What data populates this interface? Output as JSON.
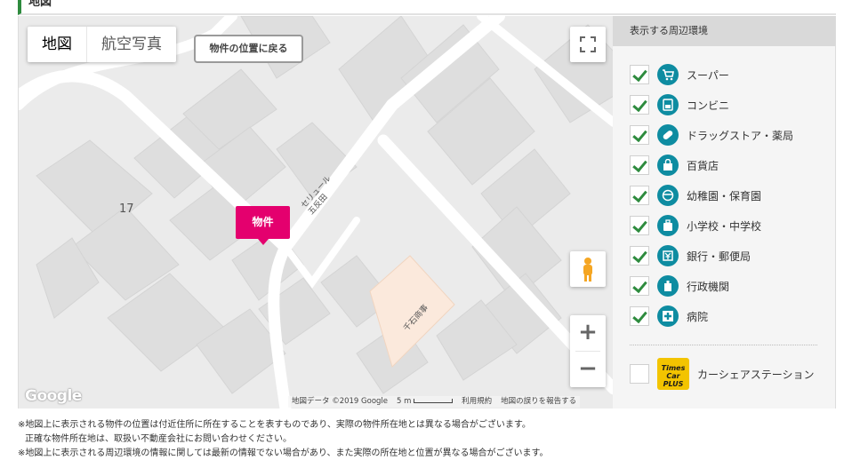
{
  "header": {
    "title": "地図"
  },
  "map": {
    "type_tabs": {
      "map": "地図",
      "satellite": "航空写真"
    },
    "return_button": "物件の位置に戻る",
    "marker_label": "物件",
    "labels": {
      "block_number": "17",
      "building": "セリュール\n五反田",
      "station": "千石商事"
    },
    "google_logo": "Google",
    "attribution": {
      "data": "地図データ ©2019 Google",
      "scale": "5 m",
      "terms": "利用規約",
      "report": "地図の誤りを報告する"
    },
    "zoom": {
      "in": "+",
      "out": "−"
    }
  },
  "panel": {
    "title": "表示する周辺環境",
    "items": [
      {
        "label": "スーパー",
        "checked": true,
        "icon": "cart-icon"
      },
      {
        "label": "コンビニ",
        "checked": true,
        "icon": "convenience-icon"
      },
      {
        "label": "ドラッグストア・薬局",
        "checked": true,
        "icon": "pill-icon"
      },
      {
        "label": "百貨店",
        "checked": true,
        "icon": "bag-icon"
      },
      {
        "label": "幼稚園・保育園",
        "checked": true,
        "icon": "child-icon"
      },
      {
        "label": "小学校・中学校",
        "checked": true,
        "icon": "school-bag-icon"
      },
      {
        "label": "銀行・郵便局",
        "checked": true,
        "icon": "bank-icon"
      },
      {
        "label": "行政機関",
        "checked": true,
        "icon": "government-icon"
      },
      {
        "label": "病院",
        "checked": true,
        "icon": "hospital-icon"
      }
    ],
    "car_share": {
      "label": "カーシェアステーション",
      "checked": false,
      "logo_text": "Times Car PLUS"
    },
    "accent_color": "#0e8ca1",
    "check_color": "#2e8b3e"
  },
  "notes": [
    "※地図上に表示される物件の位置は付近住所に所在することを表すものであり、実際の物件所在地とは異なる場合がございます。",
    "正確な物件所在地は、取扱い不動産会社にお問い合わせください。",
    "※地図上に表示される周辺環境の情報に関しては最新の情報でない場合があり、また実際の所在地と位置が異なる場合がございます。"
  ]
}
